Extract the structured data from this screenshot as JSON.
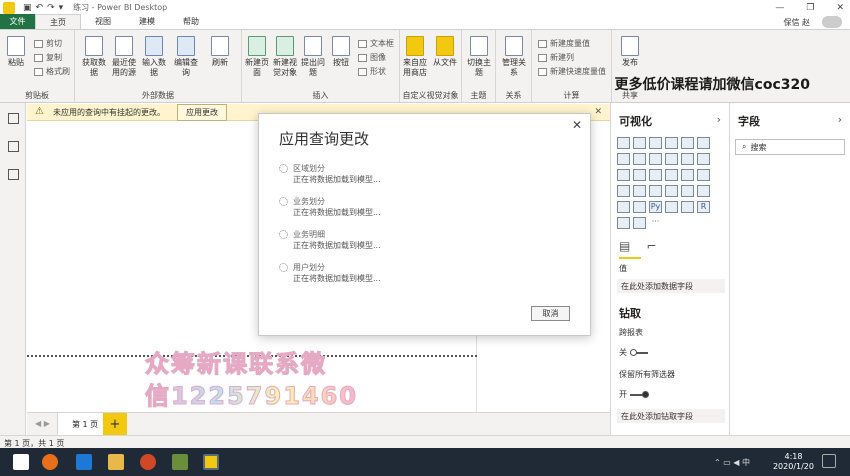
{
  "window": {
    "title": "练习 - Power BI Desktop",
    "user_name": "保信 赵"
  },
  "menu": {
    "file": "文件",
    "tabs": [
      "主页",
      "视图",
      "建模",
      "帮助"
    ],
    "active_tab": "主页"
  },
  "ribbon": {
    "clipboard": {
      "paste": "粘贴",
      "cut": "剪切",
      "copy": "复制",
      "format_painter": "格式刷",
      "label": "剪贴板"
    },
    "external_data": {
      "get_data": "获取数据",
      "recent_sources": "最近使用的源",
      "enter_data": "输入数据",
      "edit_queries": "编辑查询",
      "refresh": "刷新",
      "label": "外部数据"
    },
    "insert": {
      "new_page": "新建页面",
      "new_visual": "新建视觉对象",
      "ask_question": "提出问题",
      "buttons": "按钮",
      "textbox": "文本框",
      "image": "图像",
      "shapes": "形状",
      "label": "插入"
    },
    "custom_visuals": {
      "from_store": "来自应用商店",
      "from_file": "从文件",
      "label": "自定义视觉对象"
    },
    "themes": {
      "switch_theme": "切换主题",
      "label": "主题"
    },
    "relationships": {
      "manage": "管理关系",
      "label": "关系"
    },
    "calculations": {
      "new_measure": "新建度量值",
      "new_column": "新建列",
      "new_quick_measure": "新建快速度量值",
      "label": "计算"
    },
    "share": {
      "publish": "发布",
      "label": "共享"
    }
  },
  "promo_text": "更多低价课程请加微信coc320",
  "banner": {
    "message": "未应用的查询中有挂起的更改。",
    "apply_button": "应用更改",
    "close": "✕"
  },
  "dialog": {
    "title": "应用查询更改",
    "close": "✕",
    "items": [
      {
        "name": "区域划分",
        "status": "正在将数据加载到模型..."
      },
      {
        "name": "业务划分",
        "status": "正在将数据加载到模型..."
      },
      {
        "name": "业务明细",
        "status": "正在将数据加载到模型..."
      },
      {
        "name": "用户划分",
        "status": "正在将数据加载到模型..."
      }
    ],
    "cancel": "取消"
  },
  "visualizations_pane": {
    "title": "可视化",
    "values_label": "值",
    "values_drop": "在此处添加数据字段",
    "drillthrough_title": "钻取",
    "cross_report": "跨报表",
    "toggle_off": "关",
    "keep_filters": "保留所有筛选器",
    "toggle_on": "开",
    "drill_drop": "在此处添加钻取字段",
    "icons_row_letter_py": "Py",
    "icons_row_letter_r": "R",
    "more": "···"
  },
  "fields_pane": {
    "title": "字段",
    "search_placeholder": "搜索"
  },
  "pages": {
    "tab": "第 1 页",
    "add": "+"
  },
  "status_bar": {
    "text": "第 1 页，共 1 页"
  },
  "watermark": {
    "line1": "众筹新课联系微",
    "line2": "信1225791460"
  },
  "taskbar": {
    "time": "4:18",
    "date": "2020/1/20"
  },
  "colors": {
    "accent": "#f2c811",
    "file_tab": "#217346",
    "banner_bg": "#fff4ce",
    "taskbar_bg": "#1f2a36"
  }
}
